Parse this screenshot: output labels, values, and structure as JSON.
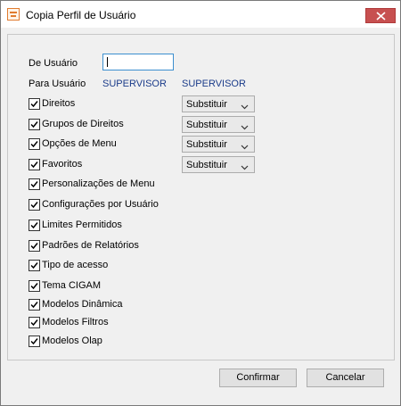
{
  "window": {
    "title": "Copia Perfil de Usuário"
  },
  "form": {
    "de_usuario_label": "De Usuário",
    "de_usuario_value": "",
    "para_usuario_label": "Para Usuário",
    "para_usuario_value": "SUPERVISOR",
    "para_usuario_value2": "SUPERVISOR"
  },
  "options": [
    {
      "label": "Direitos",
      "checked": true,
      "combo": "Substituir"
    },
    {
      "label": "Grupos de Direitos",
      "checked": true,
      "combo": "Substituir"
    },
    {
      "label": "Opções de Menu",
      "checked": true,
      "combo": "Substituir"
    },
    {
      "label": "Favoritos",
      "checked": true,
      "combo": "Substituir"
    },
    {
      "label": "Personalizações de Menu",
      "checked": true
    },
    {
      "label": "Configurações por Usuário",
      "checked": true
    },
    {
      "label": "Limites Permitidos",
      "checked": true
    },
    {
      "label": "Padrões de Relatórios",
      "checked": true
    },
    {
      "label": "Tipo de acesso",
      "checked": true
    },
    {
      "label": "Tema CIGAM",
      "checked": true
    },
    {
      "label": "Modelos Dinâmica",
      "checked": true
    },
    {
      "label": "Modelos Filtros",
      "checked": true
    },
    {
      "label": "Modelos Olap",
      "checked": true
    }
  ],
  "buttons": {
    "confirm": "Confirmar",
    "cancel": "Cancelar"
  },
  "colors": {
    "close_button": "#c75050",
    "value_text": "#1b3c8a",
    "input_focus_border": "#3c8fcf"
  }
}
